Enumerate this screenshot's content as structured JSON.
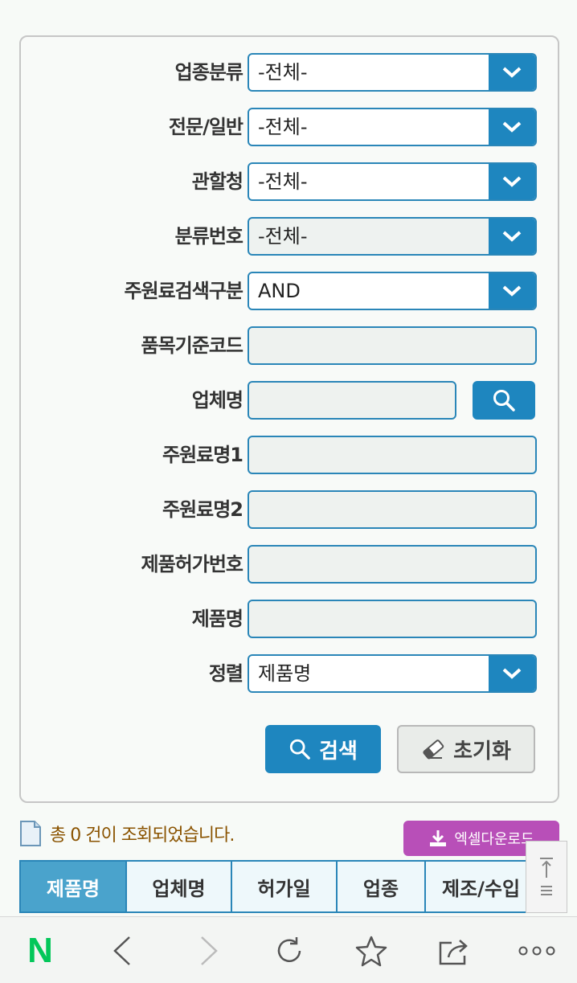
{
  "form": {
    "rows": [
      {
        "label": "업종분류",
        "type": "select",
        "value": "-전체-"
      },
      {
        "label": "전문/일반",
        "type": "select",
        "value": "-전체-"
      },
      {
        "label": "관할청",
        "type": "select",
        "value": "-전체-"
      },
      {
        "label": "분류번호",
        "type": "select",
        "value": "-전체-"
      },
      {
        "label": "주원료검색구분",
        "type": "select",
        "value": "AND"
      },
      {
        "label": "품목기준코드",
        "type": "input",
        "value": ""
      },
      {
        "label": "업체명",
        "type": "input",
        "value": ""
      },
      {
        "label": "주원료명1",
        "type": "input",
        "value": ""
      },
      {
        "label": "주원료명2",
        "type": "input",
        "value": ""
      },
      {
        "label": "제품허가번호",
        "type": "input",
        "value": ""
      },
      {
        "label": "제품명",
        "type": "input",
        "value": ""
      },
      {
        "label": "정렬",
        "type": "select",
        "value": "제품명"
      }
    ],
    "search_button": "검색",
    "reset_button": "초기화"
  },
  "result": {
    "summary": "총 0 건이 조회되었습니다.",
    "excel_button": "엑셀다운로드"
  },
  "table": {
    "columns": [
      "제품명",
      "업체명",
      "허가일",
      "업종",
      "제조/수입"
    ],
    "active_column": "제품명"
  },
  "browser": {
    "logo": "N",
    "icons": [
      "naver-logo-icon",
      "back-icon",
      "forward-icon",
      "reload-icon",
      "bookmark-star-icon",
      "share-icon",
      "more-icon"
    ]
  },
  "colors": {
    "accent": "#1e86bf",
    "excel": "#b84fb8",
    "result_text": "#8a5300",
    "naver_green": "#03c75a"
  }
}
